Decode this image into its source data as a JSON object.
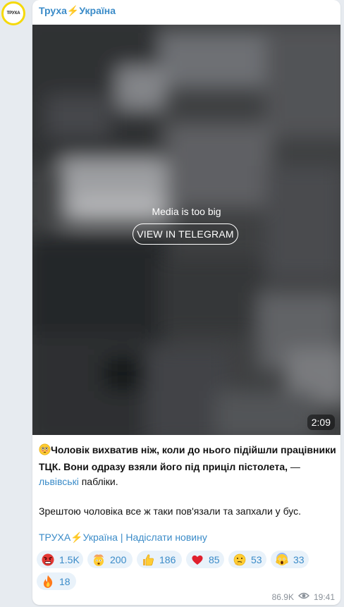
{
  "channel": {
    "name": "Труха⚡Україна",
    "avatar_text": "ТРУХА"
  },
  "media": {
    "message": "Media is too big",
    "button_label": "VIEW IN TELEGRAM",
    "duration": "2:09"
  },
  "post": {
    "bold_text": "Чоловік вихватив ніж, коли до нього підійшли працівники ТЦК. Вони одразу взяли його під приціл пістолета,",
    "dash": " — ",
    "link_text": "львівські",
    "after_link": " пабліки.",
    "paragraph2": "Зрештою чоловіка все ж таки пов'язали та запхали у бус.",
    "footer_link": "ТРУХА⚡Україна | Надіслати новину"
  },
  "reactions": [
    {
      "emoji": "angry-face-icon",
      "count": "1.5K"
    },
    {
      "emoji": "exploding-head-icon",
      "count": "200"
    },
    {
      "emoji": "thumbs-up-icon",
      "count": "186"
    },
    {
      "emoji": "red-heart-icon",
      "count": "85"
    },
    {
      "emoji": "thinking-face-icon",
      "count": "53"
    },
    {
      "emoji": "screaming-face-icon",
      "count": "33"
    },
    {
      "emoji": "fire-icon",
      "count": "18"
    }
  ],
  "meta": {
    "views": "86.9K",
    "time": "19:41"
  },
  "colors": {
    "accent": "#3a8bc8",
    "reaction_bg": "#e9f2fa",
    "page_bg": "#e7ebf0"
  }
}
